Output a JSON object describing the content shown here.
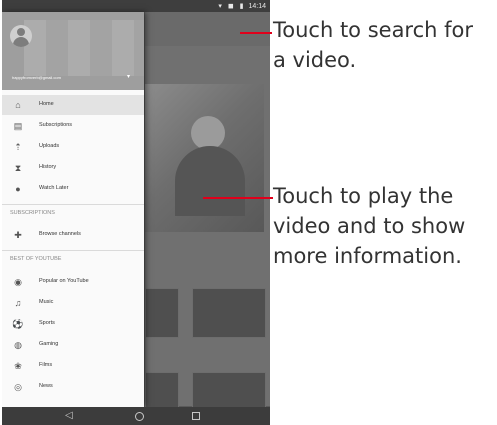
{
  "status_bar": {
    "icons": "▾ ◼ ▮",
    "time": "14:14"
  },
  "drawer": {
    "account_email": "happyfromverb@gmail.com",
    "caret": "▾",
    "items": [
      {
        "label": "Home",
        "icon": "⌂",
        "icon_name": "home-icon"
      },
      {
        "label": "Subscriptions",
        "icon": "▤",
        "icon_name": "subscriptions-icon"
      },
      {
        "label": "Uploads",
        "icon": "⇡",
        "icon_name": "upload-icon"
      },
      {
        "label": "History",
        "icon": "⧗",
        "icon_name": "history-icon"
      },
      {
        "label": "Watch Later",
        "icon": "●",
        "icon_name": "clock-icon"
      }
    ],
    "subscriptions_title": "SUBSCRIPTIONS",
    "browse_channels": {
      "label": "Browse channels",
      "icon": "✚",
      "icon_name": "add-circle-icon"
    },
    "best_title": "BEST OF YOUTUBE",
    "best_items": [
      {
        "label": "Popular on YouTube",
        "icon": "◉",
        "icon_name": "popular-icon"
      },
      {
        "label": "Music",
        "icon": "♫",
        "icon_name": "music-icon"
      },
      {
        "label": "Sports",
        "icon": "⚽",
        "icon_name": "sports-icon"
      },
      {
        "label": "Gaming",
        "icon": "◍",
        "icon_name": "gaming-icon"
      },
      {
        "label": "Films",
        "icon": "❀",
        "icon_name": "films-icon"
      },
      {
        "label": "News",
        "icon": "◎",
        "icon_name": "news-icon"
      }
    ]
  },
  "nav_bar": {
    "back": "◁"
  },
  "callouts": {
    "search": "Touch to search for\na video.",
    "play": "Touch to play the\nvideo and to show\nmore information."
  },
  "colors": {
    "callout_line": "#e0001b",
    "drawer_bg": "#fafafa",
    "active_row": "#e3e3e3"
  }
}
